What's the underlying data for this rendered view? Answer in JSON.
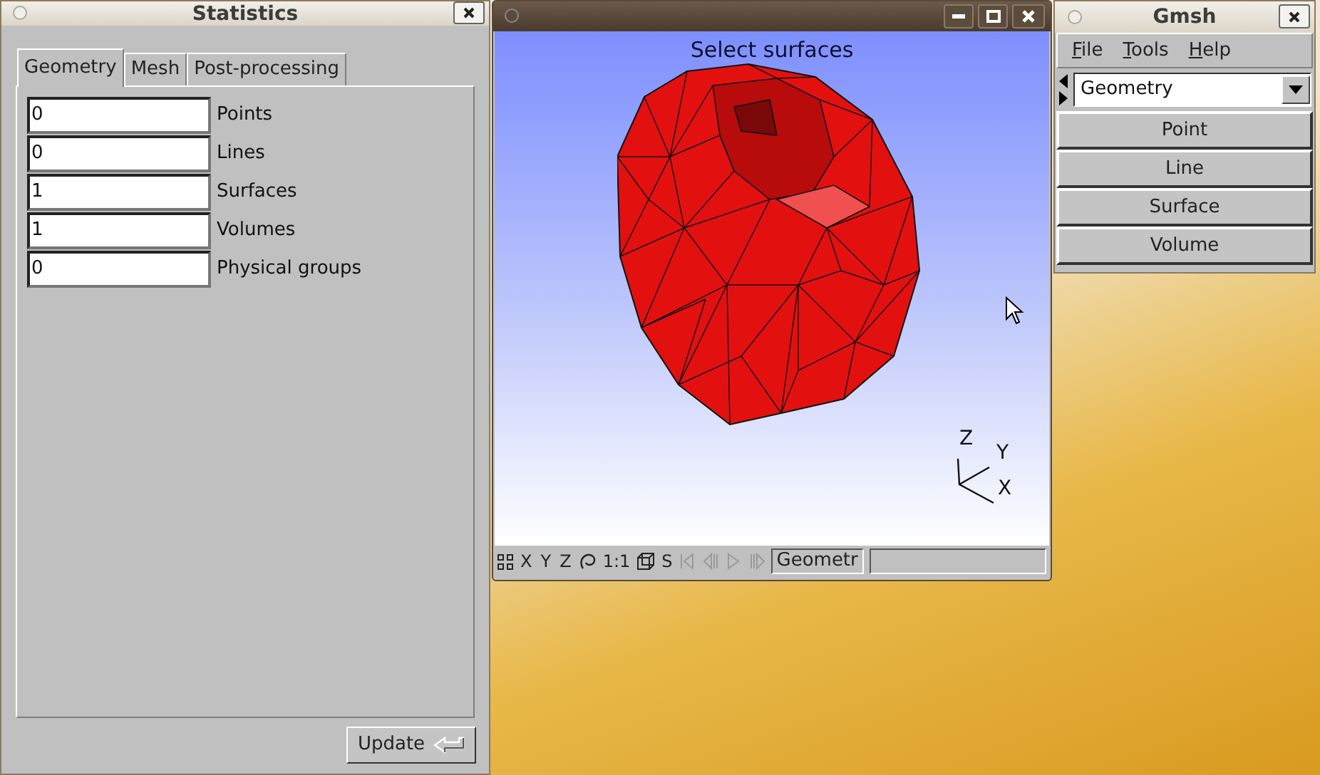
{
  "statistics_window": {
    "title": "Statistics",
    "tabs": [
      {
        "label": "Geometry",
        "selected": true
      },
      {
        "label": "Mesh",
        "selected": false
      },
      {
        "label": "Post-processing",
        "selected": false
      }
    ],
    "rows": [
      {
        "value": "0",
        "label": "Points"
      },
      {
        "value": "0",
        "label": "Lines"
      },
      {
        "value": "1",
        "label": "Surfaces"
      },
      {
        "value": "1",
        "label": "Volumes"
      },
      {
        "value": "0",
        "label": "Physical groups"
      }
    ],
    "update_button": "Update"
  },
  "graphics_window": {
    "message": "Select surfaces",
    "axes": {
      "x": "X",
      "y": "Y",
      "z": "Z"
    },
    "status_bar": {
      "view_buttons": [
        "X",
        "Y",
        "Z"
      ],
      "scale_button": "1:1",
      "s_button": "S",
      "playback_buttons": [
        {
          "disabled": true
        },
        {
          "disabled": true
        },
        {
          "disabled": true
        },
        {
          "disabled": true
        }
      ],
      "module_field": "Geometr"
    }
  },
  "gmsh_window": {
    "title": "Gmsh",
    "menu": [
      "File",
      "Tools",
      "Help"
    ],
    "module": "Geometry",
    "buttons": [
      "Point",
      "Line",
      "Surface",
      "Volume"
    ]
  }
}
